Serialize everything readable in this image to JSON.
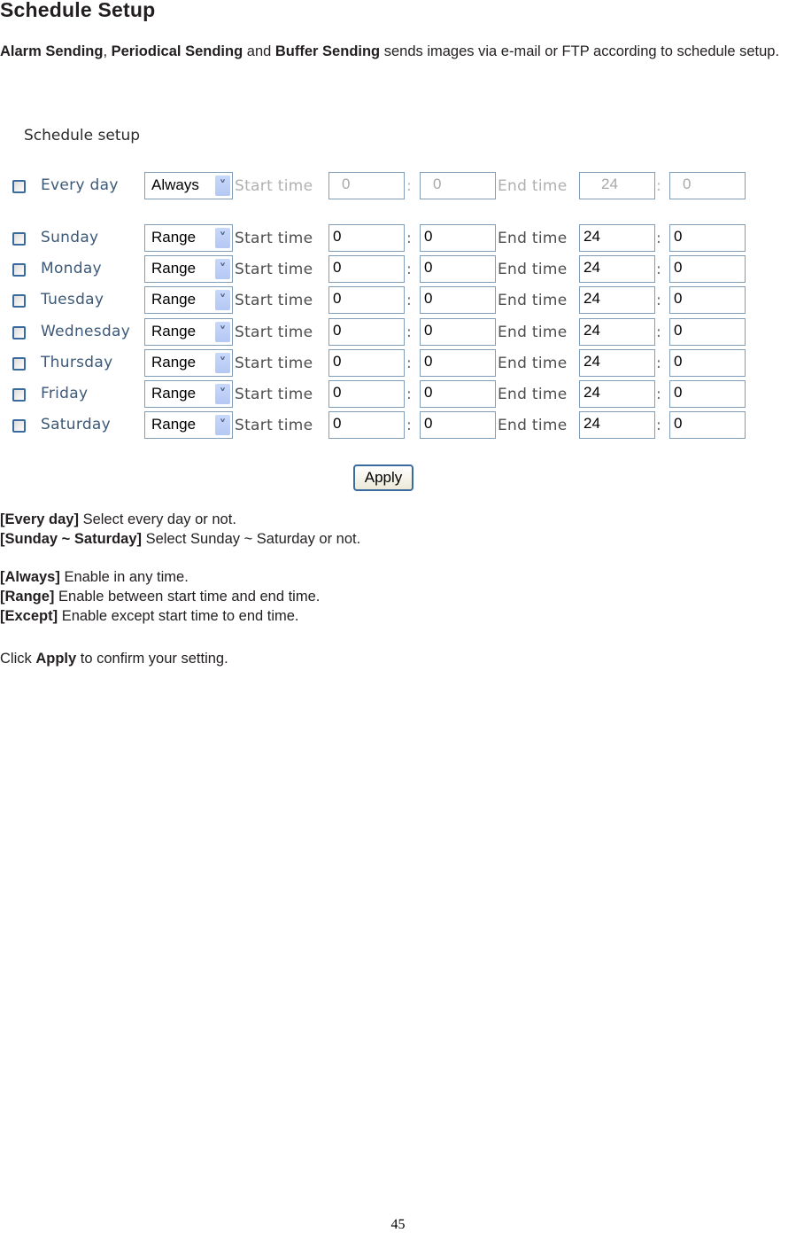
{
  "title": "Schedule Setup",
  "intro": {
    "term1": "Alarm Sending",
    "sep1": ",",
    "term2": "Periodical Sending",
    "and": "and",
    "term3": "Buffer Sending",
    "rest": "sends images via e-mail or FTP according to schedule setup."
  },
  "ui": {
    "heading": "Schedule setup",
    "start_label": "Start time",
    "end_label": "End time",
    "colon": ":",
    "apply_label": "Apply",
    "rows": [
      {
        "day": "Every day",
        "checked": false,
        "mode": "Always",
        "start_h": "0",
        "start_m": "0",
        "end_h": "24",
        "end_m": "0",
        "disabled": true
      },
      {
        "day": "Sunday",
        "checked": false,
        "mode": "Range",
        "start_h": "0",
        "start_m": "0",
        "end_h": "24",
        "end_m": "0",
        "disabled": false
      },
      {
        "day": "Monday",
        "checked": false,
        "mode": "Range",
        "start_h": "0",
        "start_m": "0",
        "end_h": "24",
        "end_m": "0",
        "disabled": false
      },
      {
        "day": "Tuesday",
        "checked": false,
        "mode": "Range",
        "start_h": "0",
        "start_m": "0",
        "end_h": "24",
        "end_m": "0",
        "disabled": false
      },
      {
        "day": "Wednesday",
        "checked": false,
        "mode": "Range",
        "start_h": "0",
        "start_m": "0",
        "end_h": "24",
        "end_m": "0",
        "disabled": false
      },
      {
        "day": "Thursday",
        "checked": false,
        "mode": "Range",
        "start_h": "0",
        "start_m": "0",
        "end_h": "24",
        "end_m": "0",
        "disabled": false
      },
      {
        "day": "Friday",
        "checked": false,
        "mode": "Range",
        "start_h": "0",
        "start_m": "0",
        "end_h": "24",
        "end_m": "0",
        "disabled": false
      },
      {
        "day": "Saturday",
        "checked": false,
        "mode": "Range",
        "start_h": "0",
        "start_m": "0",
        "end_h": "24",
        "end_m": "0",
        "disabled": false
      }
    ]
  },
  "notes": [
    {
      "term": "[Every day]",
      "text": "Select every day or not."
    },
    {
      "term": "[Sunday ~ Saturday]",
      "text": "Select Sunday ~ Saturday or not."
    },
    {
      "term": "[Always]",
      "text": "Enable in any time."
    },
    {
      "term": "[Range]",
      "text": "Enable between start time and end time."
    },
    {
      "term": "[Except]",
      "text": "Enable except start time to end time."
    }
  ],
  "footer_note": {
    "prefix": "Click",
    "term": "Apply",
    "suffix": "to confirm your setting."
  },
  "page_number": "45"
}
